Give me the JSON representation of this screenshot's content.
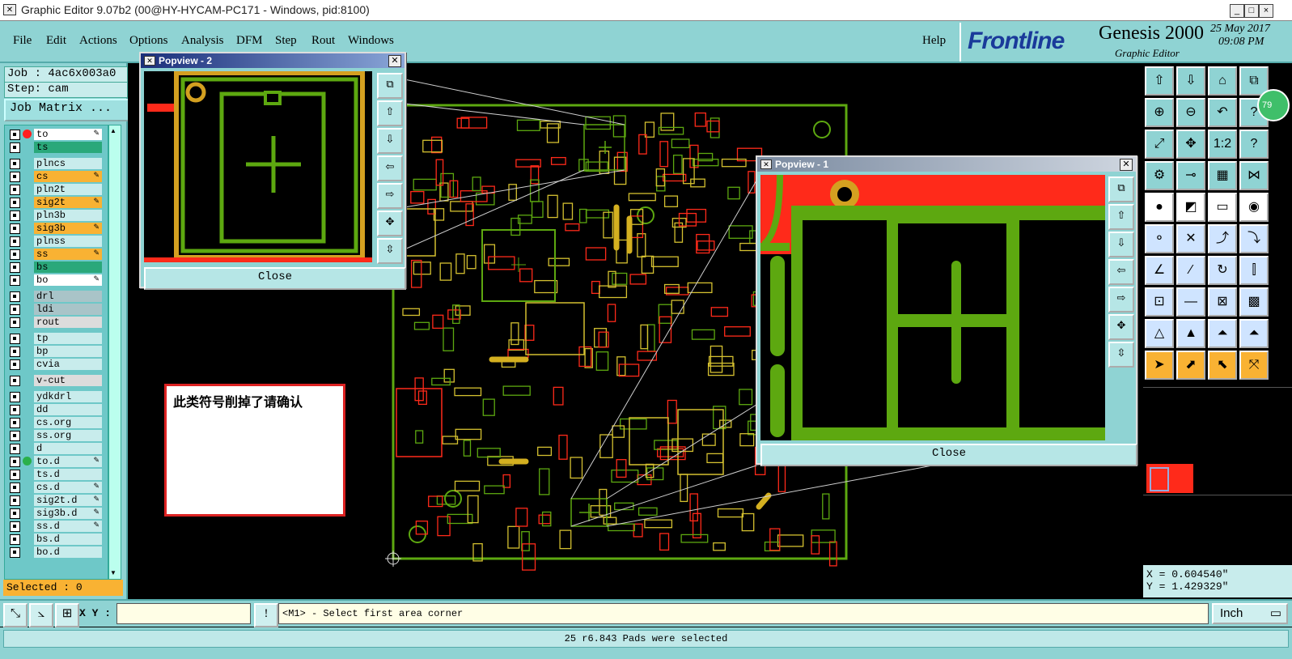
{
  "window": {
    "title": "Graphic Editor 9.07b2 (00@HY-HYCAM-PC171 - Windows, pid:8100)",
    "controls": [
      "_",
      "□",
      "×"
    ]
  },
  "menu": {
    "items": [
      "File",
      "Edit",
      "Actions",
      "Options",
      "Analysis",
      "DFM",
      "Step",
      "Rout",
      "Windows"
    ],
    "help": "Help"
  },
  "brand": {
    "logo": "Frontline",
    "product": "Genesis 2000",
    "subtitle": "Graphic Editor",
    "date": "25 May 2017",
    "time": "09:08 PM"
  },
  "job": {
    "job_label": "Job : 4ac6x003a0",
    "step_label": "Step: cam",
    "matrix_button": "Job Matrix ..."
  },
  "layers": [
    {
      "name": "to",
      "color": "#ffffff",
      "marker": "red",
      "edit": true
    },
    {
      "name": "ts",
      "color": "#2aa87a",
      "marker": "",
      "edit": false
    },
    {
      "name": "plncs",
      "color": "#c8ecec",
      "marker": "",
      "edit": false
    },
    {
      "name": "cs",
      "color": "#f9b233",
      "marker": "",
      "edit": true
    },
    {
      "name": "pln2t",
      "color": "#c8ecec",
      "marker": "",
      "edit": false
    },
    {
      "name": "sig2t",
      "color": "#f9b233",
      "marker": "",
      "edit": true
    },
    {
      "name": "pln3b",
      "color": "#c8ecec",
      "marker": "",
      "edit": false
    },
    {
      "name": "sig3b",
      "color": "#f9b233",
      "marker": "",
      "edit": true
    },
    {
      "name": "plnss",
      "color": "#c8ecec",
      "marker": "",
      "edit": false
    },
    {
      "name": "ss",
      "color": "#f9b233",
      "marker": "",
      "edit": true
    },
    {
      "name": "bs",
      "color": "#2aa87a",
      "marker": "",
      "edit": false
    },
    {
      "name": "bo",
      "color": "#ffffff",
      "marker": "",
      "edit": true
    },
    {
      "name": "drl",
      "color": "#a9c4c8",
      "marker": "",
      "edit": false
    },
    {
      "name": "ldi",
      "color": "#a9c4c8",
      "marker": "",
      "edit": false
    },
    {
      "name": "rout",
      "color": "#dcdcdc",
      "marker": "",
      "edit": false
    },
    {
      "name": "tp",
      "color": "#c8ecec",
      "marker": "",
      "edit": false
    },
    {
      "name": "bp",
      "color": "#c8ecec",
      "marker": "",
      "edit": false
    },
    {
      "name": "cvia",
      "color": "#c8ecec",
      "marker": "",
      "edit": false
    },
    {
      "name": "v-cut",
      "color": "#dcdcdc",
      "marker": "",
      "edit": false
    },
    {
      "name": "ydkdrl",
      "color": "#c8ecec",
      "marker": "",
      "edit": false
    },
    {
      "name": "dd",
      "color": "#c8ecec",
      "marker": "",
      "edit": false
    },
    {
      "name": "cs.org",
      "color": "#c8ecec",
      "marker": "",
      "edit": false
    },
    {
      "name": "ss.org",
      "color": "#c8ecec",
      "marker": "",
      "edit": false
    },
    {
      "name": "d",
      "color": "#c8ecec",
      "marker": "",
      "edit": false
    },
    {
      "name": "to.d",
      "color": "#c8ecec",
      "marker": "green",
      "edit": true
    },
    {
      "name": "ts.d",
      "color": "#c8ecec",
      "marker": "",
      "edit": false
    },
    {
      "name": "cs.d",
      "color": "#c8ecec",
      "marker": "",
      "edit": true
    },
    {
      "name": "sig2t.d",
      "color": "#c8ecec",
      "marker": "",
      "edit": true
    },
    {
      "name": "sig3b.d",
      "color": "#c8ecec",
      "marker": "",
      "edit": true
    },
    {
      "name": "ss.d",
      "color": "#c8ecec",
      "marker": "",
      "edit": true
    },
    {
      "name": "bs.d",
      "color": "#c8ecec",
      "marker": "",
      "edit": false
    },
    {
      "name": "bo.d",
      "color": "#c8ecec",
      "marker": "",
      "edit": false
    }
  ],
  "selected": "Selected : 0",
  "popview2": {
    "title": "Popview - 2",
    "close": "Close"
  },
  "popview1": {
    "title": "Popview - 1",
    "close": "Close"
  },
  "note": "此类符号削掉了请确认",
  "coords": {
    "x": "X = 0.604540\"",
    "y": "Y = 1.429329\""
  },
  "bottom": {
    "xy_label": "X Y :",
    "xy_value": "",
    "prompt": "<M1> - Select first area corner",
    "units": "Inch",
    "status": "25 r6.843 Pads were selected"
  },
  "badge": "79",
  "toolbar_icons": [
    "home-up-icon",
    "home-down-icon",
    "home-icon",
    "window-icon",
    "zoom-in-icon",
    "zoom-out-icon",
    "zoom-back-icon",
    "help-icon",
    "fit-icon",
    "pan-icon",
    "one-to-one-icon",
    "query-icon",
    "palette-icon",
    "snap-icon",
    "layers-icon",
    "net-icon",
    "select-icon",
    "measure-icon",
    "ruler-icon",
    "pad-icon",
    "connect-icon",
    "delete-icon",
    "move-icon",
    "copy-icon",
    "line-icon",
    "arc-icon",
    "rotate-icon",
    "mirror-icon",
    "split-icon",
    "cut-icon",
    "resize-icon",
    "clip-icon",
    "triangle-icon",
    "arrow-up-icon",
    "polygon-icon",
    "polygon2-icon",
    "pointer-icon",
    "pointer-box-icon",
    "pointer-fill-icon",
    "pointer-move-icon"
  ],
  "colors": {
    "teal": "#8fd3d3",
    "orange": "#f9b233",
    "green": "#5da810",
    "red": "#ff2a1a"
  }
}
